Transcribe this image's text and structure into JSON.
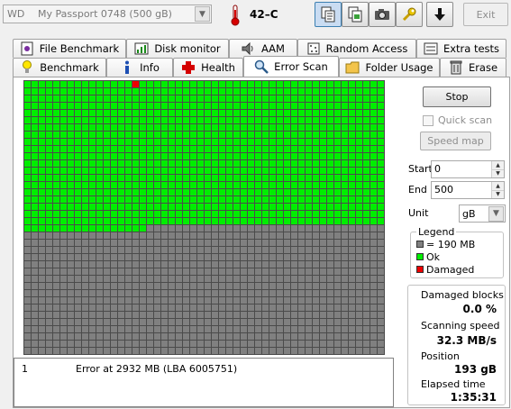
{
  "toolbar": {
    "drive_brand": "WD",
    "drive_model": "My Passport 0748 (500 gB)",
    "temperature": "42–C",
    "buttons": [
      {
        "name": "copy-text-button",
        "icon": "copy-text-icon",
        "active": true
      },
      {
        "name": "copy-image-button",
        "icon": "copy-image-icon",
        "active": false
      },
      {
        "name": "screenshot-button",
        "icon": "camera-icon",
        "active": false
      },
      {
        "name": "options-button",
        "icon": "wrench-icon",
        "active": false
      },
      {
        "name": "save-button",
        "icon": "down-arrow-icon",
        "active": false
      }
    ],
    "exit_label": "Exit"
  },
  "tabs": {
    "row1": [
      {
        "label": "File Benchmark",
        "icon": "file-benchmark-icon"
      },
      {
        "label": "Disk monitor",
        "icon": "disk-monitor-icon"
      },
      {
        "label": "AAM",
        "icon": "speaker-icon"
      },
      {
        "label": "Random Access",
        "icon": "random-access-icon"
      },
      {
        "label": "Extra tests",
        "icon": "extra-tests-icon"
      }
    ],
    "row2": [
      {
        "label": "Benchmark",
        "icon": "lightbulb-icon"
      },
      {
        "label": "Info",
        "icon": "info-icon"
      },
      {
        "label": "Health",
        "icon": "health-cross-icon"
      },
      {
        "label": "Error Scan",
        "icon": "magnifier-icon",
        "selected": true
      },
      {
        "label": "Folder Usage",
        "icon": "folder-icon"
      },
      {
        "label": "Erase",
        "icon": "trash-icon"
      }
    ]
  },
  "scan_map": {
    "columns": 50,
    "rows": 38,
    "ok_blocks": 1017,
    "damaged_block_index": 15,
    "colors": {
      "ok": "#00ee00",
      "unscanned": "#808080",
      "damaged": "#ee0000"
    }
  },
  "controls": {
    "stop_label": "Stop",
    "quick_scan_label": "Quick scan",
    "quick_scan_checked": false,
    "speed_map_label": "Speed map",
    "start_label": "Start",
    "start_value": "0",
    "end_label": "End",
    "end_value": "500",
    "unit_label": "Unit",
    "unit_value": "gB"
  },
  "legend": {
    "title": "Legend",
    "block_size": "= 190 MB",
    "ok": "Ok",
    "damaged": "Damaged"
  },
  "stats": {
    "damaged_label": "Damaged blocks",
    "damaged_value": "0.0 %",
    "speed_label": "Scanning speed",
    "speed_value": "32.3 MB/s",
    "position_label": "Position",
    "position_value": "193 gB",
    "elapsed_label": "Elapsed time",
    "elapsed_value": "1:35:31"
  },
  "log": [
    {
      "num": "1",
      "text": "Error at 2932 MB (LBA 6005751)"
    }
  ]
}
